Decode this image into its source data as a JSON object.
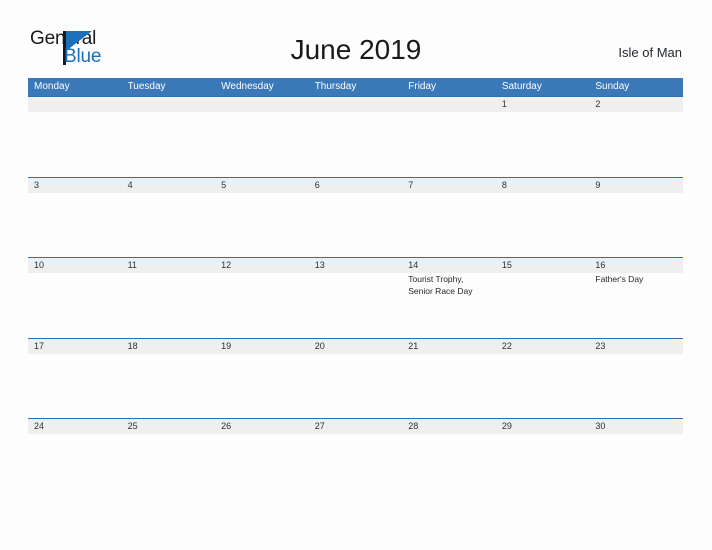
{
  "brand": {
    "name_part1": "General",
    "name_part2": "Blue",
    "accent_color": "#1c6fb8"
  },
  "header": {
    "title": "June 2019",
    "location": "Isle of Man"
  },
  "calendar": {
    "header_color": "#3b78b8",
    "date_band_color": "#efeff0",
    "rule_color": "#2c72b3",
    "weekdays": [
      "Monday",
      "Tuesday",
      "Wednesday",
      "Thursday",
      "Friday",
      "Saturday",
      "Sunday"
    ],
    "weeks": [
      {
        "days": [
          {
            "date": "",
            "events": []
          },
          {
            "date": "",
            "events": []
          },
          {
            "date": "",
            "events": []
          },
          {
            "date": "",
            "events": []
          },
          {
            "date": "",
            "events": []
          },
          {
            "date": "1",
            "events": []
          },
          {
            "date": "2",
            "events": []
          }
        ]
      },
      {
        "days": [
          {
            "date": "3",
            "events": []
          },
          {
            "date": "4",
            "events": []
          },
          {
            "date": "5",
            "events": []
          },
          {
            "date": "6",
            "events": []
          },
          {
            "date": "7",
            "events": []
          },
          {
            "date": "8",
            "events": []
          },
          {
            "date": "9",
            "events": []
          }
        ]
      },
      {
        "days": [
          {
            "date": "10",
            "events": []
          },
          {
            "date": "11",
            "events": []
          },
          {
            "date": "12",
            "events": []
          },
          {
            "date": "13",
            "events": []
          },
          {
            "date": "14",
            "events": [
              "Tourist Trophy,",
              "Senior Race Day"
            ]
          },
          {
            "date": "15",
            "events": []
          },
          {
            "date": "16",
            "events": [
              "Father's Day"
            ]
          }
        ]
      },
      {
        "days": [
          {
            "date": "17",
            "events": []
          },
          {
            "date": "18",
            "events": []
          },
          {
            "date": "19",
            "events": []
          },
          {
            "date": "20",
            "events": []
          },
          {
            "date": "21",
            "events": []
          },
          {
            "date": "22",
            "events": []
          },
          {
            "date": "23",
            "events": []
          }
        ]
      },
      {
        "days": [
          {
            "date": "24",
            "events": []
          },
          {
            "date": "25",
            "events": []
          },
          {
            "date": "26",
            "events": []
          },
          {
            "date": "27",
            "events": []
          },
          {
            "date": "28",
            "events": []
          },
          {
            "date": "29",
            "events": []
          },
          {
            "date": "30",
            "events": []
          }
        ]
      }
    ]
  }
}
